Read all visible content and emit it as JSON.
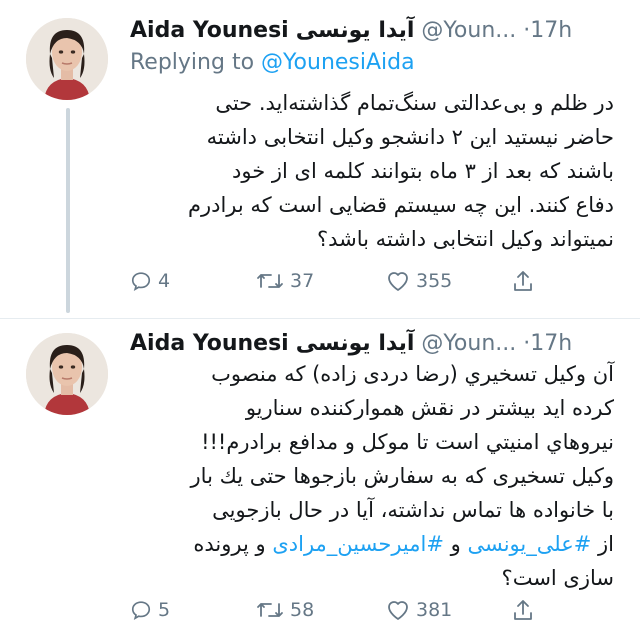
{
  "tweets": [
    {
      "display_name": "Aida Younesi",
      "display_name_fa": "آیدا یونسی",
      "handle": "@Youn...",
      "dot": "·",
      "time": "17h",
      "replying_prefix": "Replying to",
      "replying_to": "@YounesiAida",
      "lines": [
        "در ظلم و بی‌عدالتی سنگ‌تمام گذاشته‌اید. حتی",
        "حاضر نیستید این ۲ دانشجو وکیل انتخابی داشته",
        "باشند که بعد از ۳ ماه بتوانند کلمه ای از خود",
        "دفاع کنند. این چه سیستم قضایی است که برادرم",
        "نمیتواند وکیل انتخابی داشته باشد؟"
      ],
      "replies": "4",
      "retweets": "37",
      "likes": "355"
    },
    {
      "display_name": "Aida Younesi",
      "display_name_fa": "آیدا یونسی",
      "handle": "@Youn...",
      "dot": "·",
      "time": "17h",
      "line1": "آن وکیل تسخیري (رضا دردی زاده) که منصوب",
      "line2": "کرده اید بیشتر در نقش هموارکننده سناریو",
      "line3": "نیروهاي امنیتي است تا موکل و مدافع برادرم!!!",
      "line4": "وکیل تسخیری که به سفارش بازجوها حتی یك بار",
      "line5": "با خانواده ها تماس نداشته، آیا در حال بازجویی",
      "line6_prefix": "از",
      "hashtag1": "#علی_یونسی",
      "line6_mid": "و",
      "hashtag2": "#امیرحسین_مرادی",
      "line6_suffix": "و پرونده",
      "line7": "سازی است؟",
      "replies": "5",
      "retweets": "58",
      "likes": "381"
    }
  ],
  "icons": {
    "reply": "reply-icon",
    "retweet": "retweet-icon",
    "like": "heart-icon",
    "share": "share-icon"
  },
  "colors": {
    "link": "#1da1f2",
    "secondary": "#657786",
    "thread_line": "#ccd6dd",
    "divider": "#e6ecf0"
  }
}
